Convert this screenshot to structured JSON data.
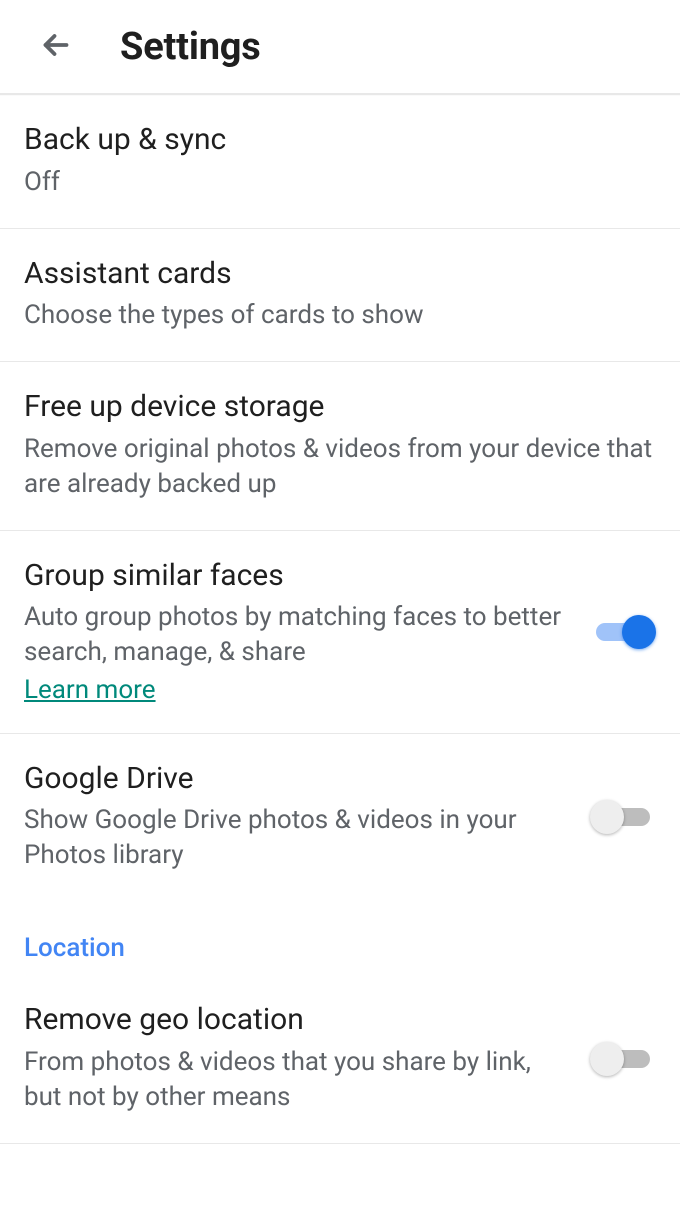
{
  "header": {
    "title": "Settings"
  },
  "items": {
    "backup": {
      "title": "Back up & sync",
      "sub": "Off"
    },
    "assistant": {
      "title": "Assistant cards",
      "sub": "Choose the types of cards to show"
    },
    "freeup": {
      "title": "Free up device storage",
      "sub": "Remove original photos & videos from your device that are already backed up"
    },
    "faces": {
      "title": "Group similar faces",
      "sub": "Auto group photos by matching faces to better search, manage, & share",
      "learn_more": "Learn more",
      "toggle_on": true
    },
    "drive": {
      "title": "Google Drive",
      "sub": "Show Google Drive photos & videos in your Photos library",
      "toggle_on": false
    },
    "geo": {
      "title": "Remove geo location",
      "sub": "From photos & videos that you share by link, but not by other means",
      "toggle_on": false
    }
  },
  "sections": {
    "location": "Location"
  }
}
